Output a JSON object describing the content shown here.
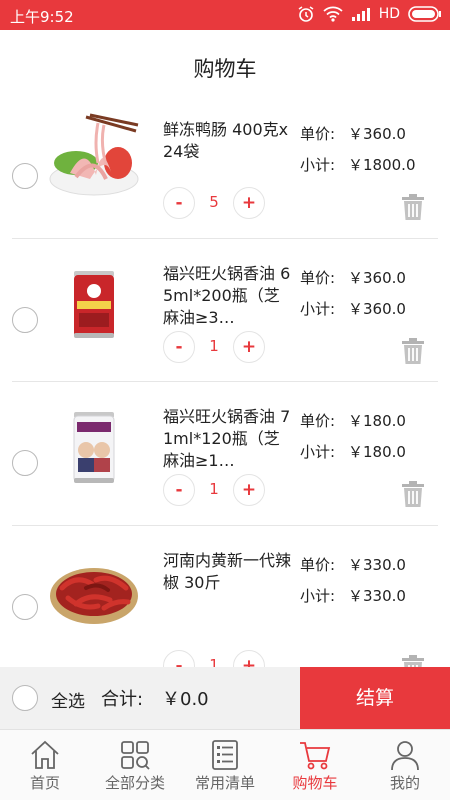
{
  "status_bar": {
    "time": "上午9:52",
    "network": "HD",
    "icons": [
      "alarm-icon",
      "wifi-icon",
      "signal-icon",
      "battery-icon"
    ]
  },
  "header": {
    "title": "购物车"
  },
  "labels": {
    "unit_price": "单价:",
    "subtotal": "小计:",
    "minus": "-",
    "plus": "+"
  },
  "cart": {
    "items": [
      {
        "name": "鲜冻鸭肠 400克x24袋",
        "unit_price": "￥360.0",
        "subtotal": "￥1800.0",
        "quantity": "5",
        "image": "duck-intestine-image"
      },
      {
        "name": "福兴旺火锅香油 65ml*200瓶（芝麻油≥3…",
        "unit_price": "￥360.0",
        "subtotal": "￥360.0",
        "quantity": "1",
        "image": "sesame-oil-can-red-image"
      },
      {
        "name": "福兴旺火锅香油 71ml*120瓶（芝麻油≥1…",
        "unit_price": "￥180.0",
        "subtotal": "￥180.0",
        "quantity": "1",
        "image": "sesame-oil-can-white-image"
      },
      {
        "name": "河南内黄新一代辣椒 30斤",
        "unit_price": "￥330.0",
        "subtotal": "￥330.0",
        "quantity": "1",
        "image": "dried-chili-image"
      }
    ]
  },
  "checkout": {
    "select_all": "全选",
    "total_label": "合计:",
    "total_value": "￥0.0",
    "button": "结算"
  },
  "tabs": [
    {
      "label": "首页",
      "icon": "home-icon",
      "active": false
    },
    {
      "label": "全部分类",
      "icon": "category-grid-icon",
      "active": false
    },
    {
      "label": "常用清单",
      "icon": "list-icon",
      "active": false
    },
    {
      "label": "购物车",
      "icon": "cart-icon",
      "active": true
    },
    {
      "label": "我的",
      "icon": "user-icon",
      "active": false
    }
  ],
  "colors": {
    "accent": "#e8393d",
    "checkout_bar": "#f1f1f1",
    "divider": "#e6e6e6"
  }
}
